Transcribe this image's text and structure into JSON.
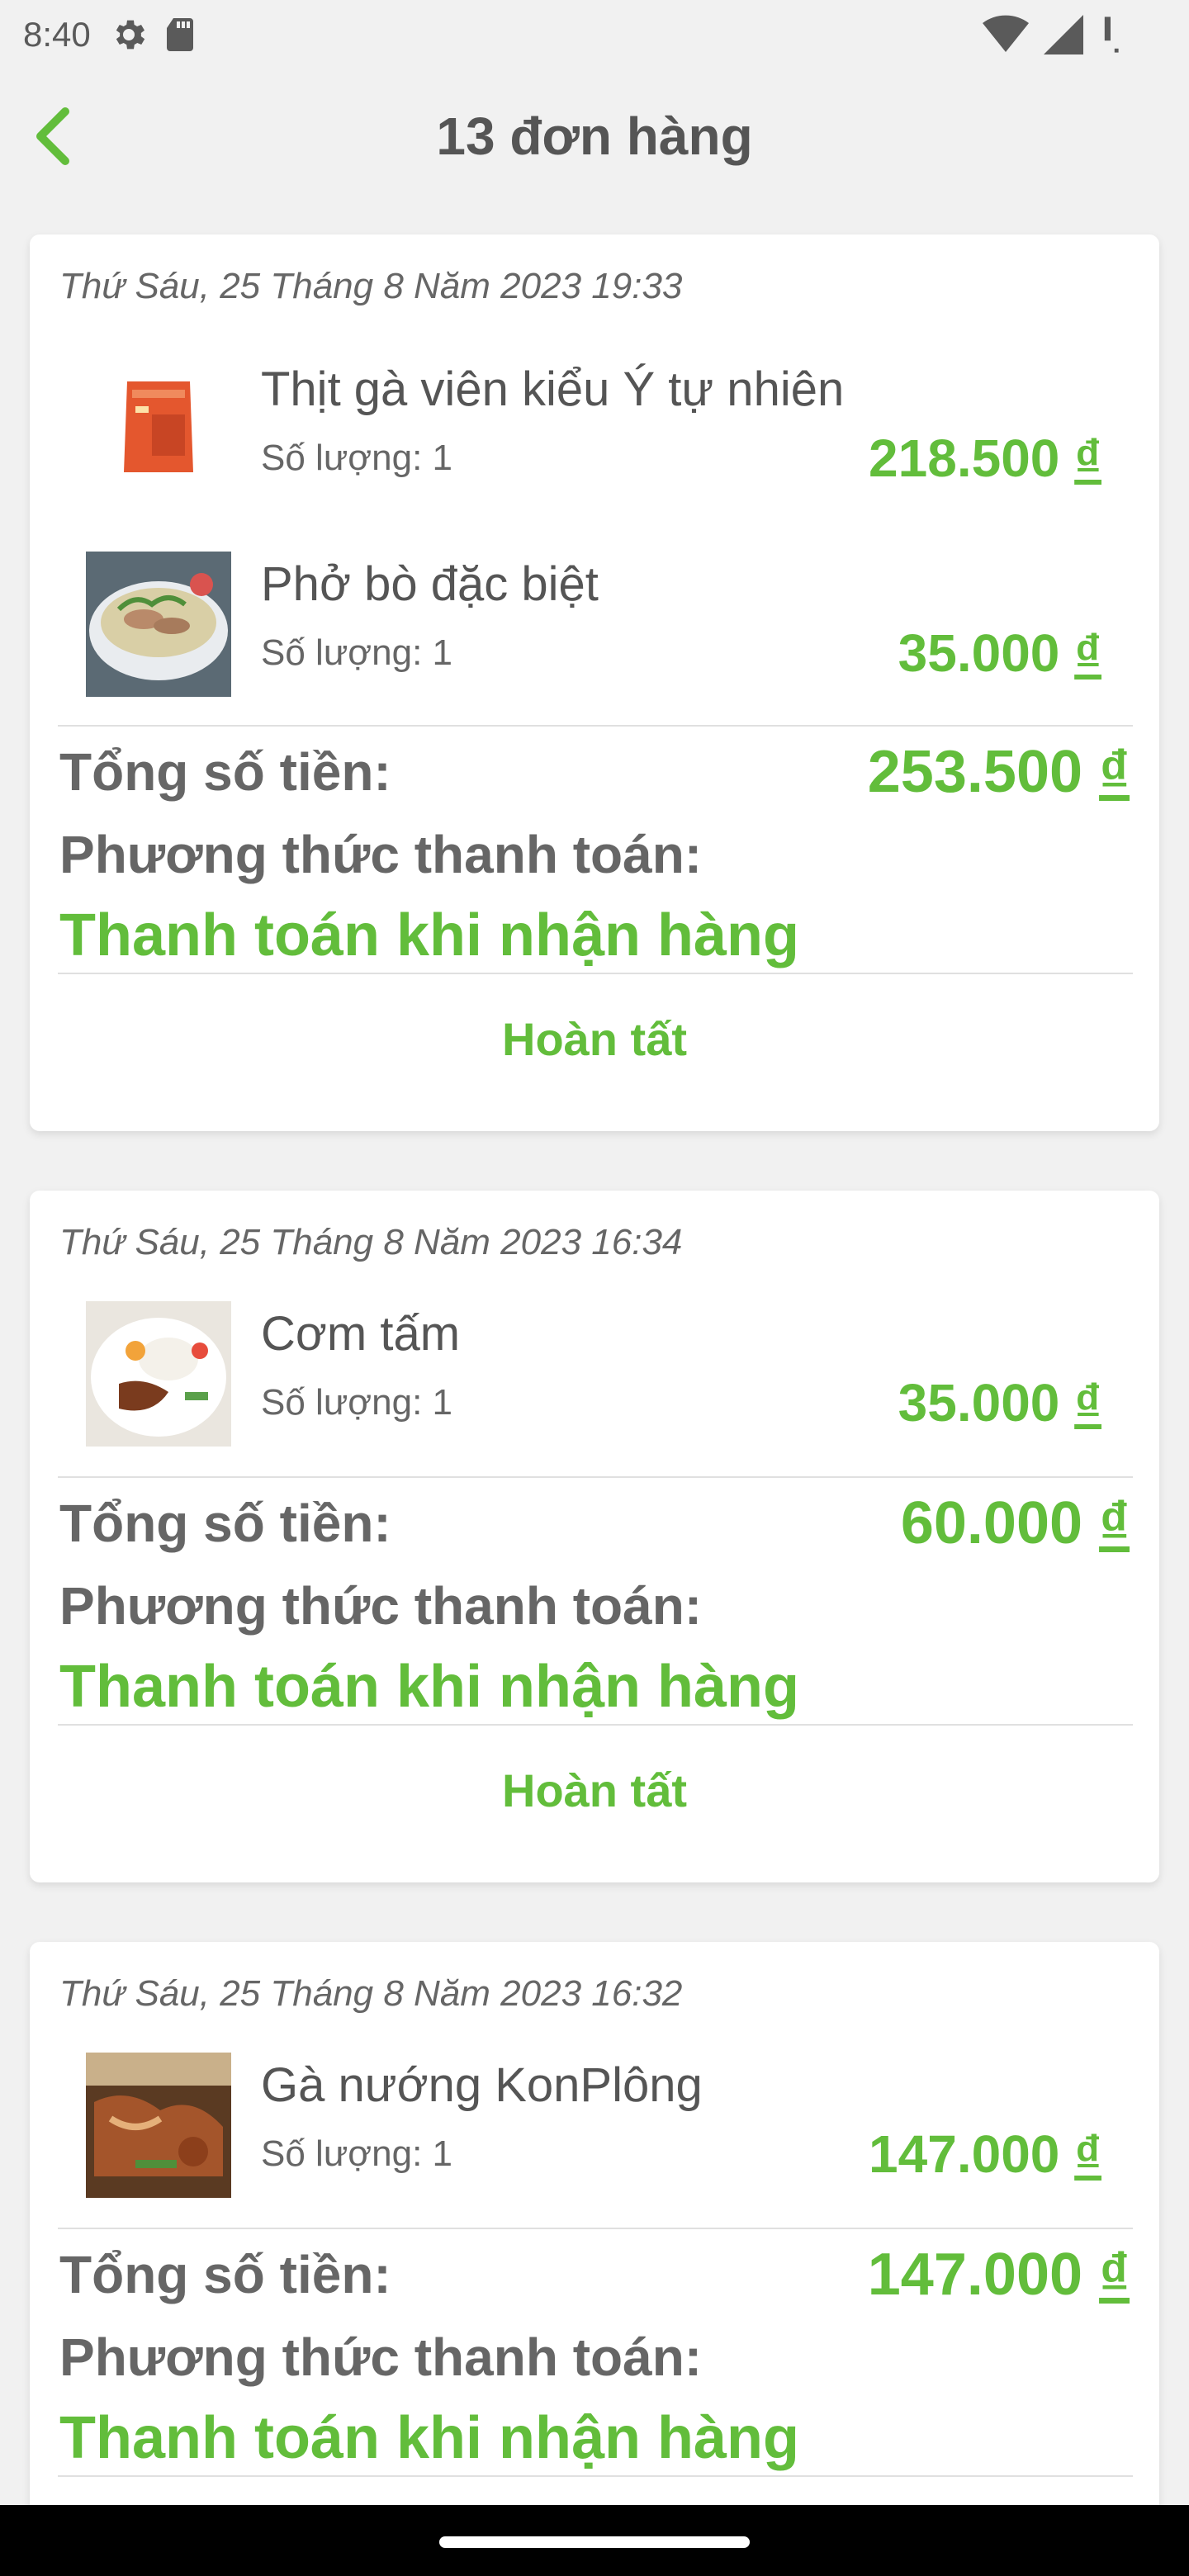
{
  "status_bar": {
    "time": "8:40",
    "icons": [
      "gear-icon",
      "sd-card-icon",
      "wifi-icon",
      "signal-icon",
      "battery-icon"
    ]
  },
  "header": {
    "title": "13 đơn hàng",
    "back_icon": "chevron-left-icon"
  },
  "colors": {
    "accent": "#62bd3b",
    "text": "#555555",
    "background": "#f1f1f1"
  },
  "orders": [
    {
      "date": "Thứ Sáu, 25 Tháng 8 Năm 2023 19:33",
      "items": [
        {
          "name": "Thịt gà viên kiểu Ý tự nhiên",
          "qty": "Số lượng: 1",
          "price": "218.500",
          "currency": "₫"
        },
        {
          "name": "Phở bò đặc biệt",
          "qty": "Số lượng: 1",
          "price": "35.000",
          "currency": "₫"
        }
      ],
      "total_label": "Tổng số tiền:",
      "total": "253.500",
      "currency": "₫",
      "payment_label": "Phương thức thanh toán:",
      "payment_method": "Thanh toán khi nhận hàng",
      "status": "Hoàn tất"
    },
    {
      "date": "Thứ Sáu, 25 Tháng 8 Năm 2023 16:34",
      "items": [
        {
          "name": "Cơm tấm",
          "qty": "Số lượng: 1",
          "price": "35.000",
          "currency": "₫"
        }
      ],
      "total_label": "Tổng số tiền:",
      "total": "60.000",
      "currency": "₫",
      "payment_label": "Phương thức thanh toán:",
      "payment_method": "Thanh toán khi nhận hàng",
      "status": "Hoàn tất"
    },
    {
      "date": "Thứ Sáu, 25 Tháng 8 Năm 2023 16:32",
      "items": [
        {
          "name": "Gà nướng KonPlông",
          "qty": "Số lượng: 1",
          "price": "147.000",
          "currency": "₫"
        }
      ],
      "total_label": "Tổng số tiền:",
      "total": "147.000",
      "currency": "₫",
      "payment_label": "Phương thức thanh toán:",
      "payment_method": "Thanh toán khi nhận hàng"
    }
  ]
}
